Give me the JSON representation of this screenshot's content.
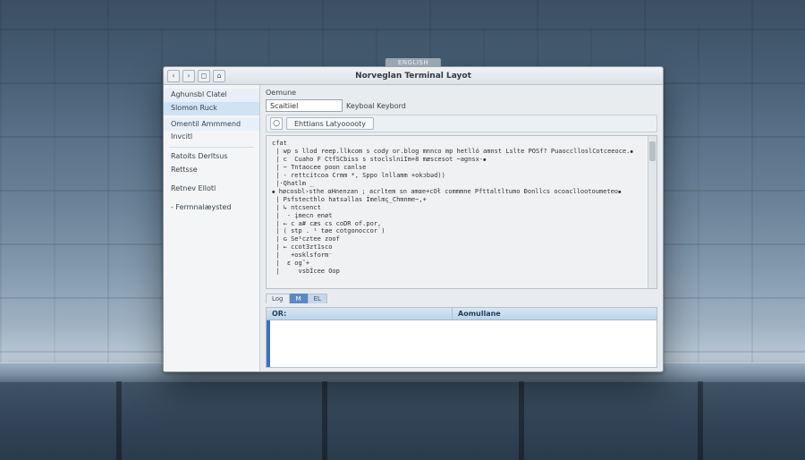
{
  "window": {
    "tab": "ENGLISH",
    "title": "Norveglan Terminal Layot"
  },
  "sidebar": {
    "items": [
      "Aghunsbl Clatel",
      "Slomon Ruck",
      "Omentil Ammmend",
      "Invcitl",
      "Ratoits Derltsus",
      "Rettsse",
      "Retnev Ellotl",
      "- Fermnalæysted"
    ]
  },
  "form": {
    "name_label": "Oemune",
    "name_value": "Scaitiiel",
    "name_trail": "Keyboal Keybord"
  },
  "toolbar": {
    "layout_button": "Ehttians Latyooooty"
  },
  "editor": {
    "text": "cfat\n | wp s llod reep.llkcom s cody or.blog mnnco mp hetlló amnst Lslte POSf? PuaocclloslCotceeoce.⦁\n | c  Cuaho F CtfSCbiss s stoclslniIm+8 mæscesot ~agnsx-⦁\n | ~ Tntaocee poon canlse\n | - rettcitcoa Crmm *, Sppo lnllamm +okɔbəd))\n |·Qhatlm _\n⦁ høcosbl›sthe αHnenzan ; acrltem sn amαe+cOł commmne Pfttaltltumo Đonllcs ocoacllootoumeteo⦁\n | Psfstecthlo hatsəllas İmelmç_Chmnme~,+\n | ↳ ntcsenct\n |  - įmecn enøt\n | ← c a# cæs cs coDR of.por,\n | ⟨ stp . ¹ tøe cotgonoccor˙)\n | ɢ Se¹cztee zoof\n | ← ccot3zt1sco\n |   +osklsform⁻\n |  ɛ og˜+\n |     vsbİcee Oop"
  },
  "bottom_tabs": [
    "Log",
    "M",
    "EL"
  ],
  "table": {
    "columns": [
      "OR:",
      "Aomullane"
    ]
  }
}
